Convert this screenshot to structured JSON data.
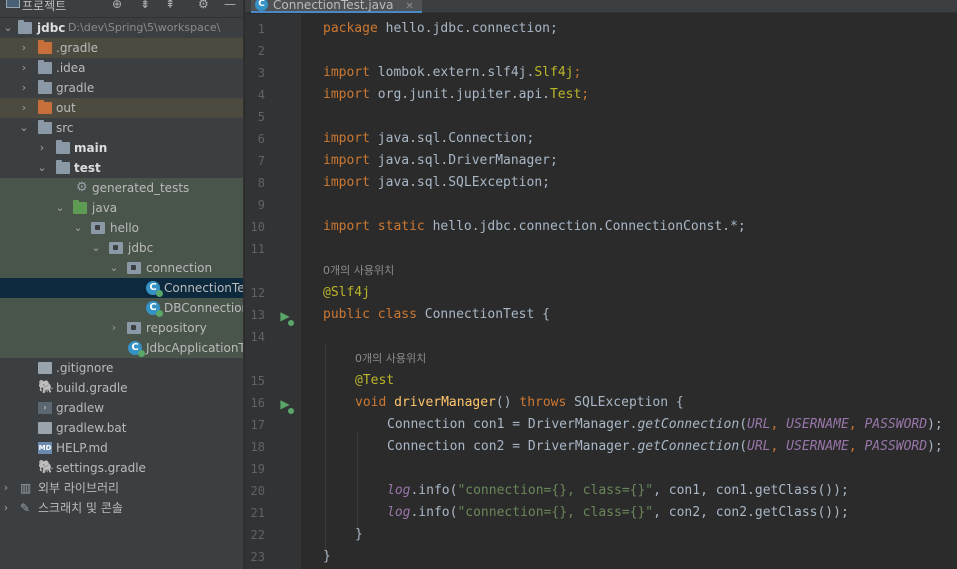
{
  "panel": {
    "title": "프로젝트",
    "toolbar_icons": [
      "locate-icon",
      "expand-icon",
      "collapse-icon",
      "gear-icon",
      "minimize-icon"
    ]
  },
  "tree": {
    "root": {
      "name": "jdbc",
      "path": "D:\\dev\\Spring\\5\\workspace\\"
    },
    "gradle_dir": ".gradle",
    "idea": ".idea",
    "gradle": "gradle",
    "out": "out",
    "src": "src",
    "main": "main",
    "test": "test",
    "generated_tests": "generated_tests",
    "java": "java",
    "hello": "hello",
    "jdbc_pkg": "jdbc",
    "connection_pkg": "connection",
    "connection_test": "ConnectionTes",
    "db_connection": "DBConnection",
    "repository": "repository",
    "jdbc_app_test": "JdbcApplicationTe",
    "gitignore": ".gitignore",
    "build_gradle": "build.gradle",
    "gradlew": "gradlew",
    "gradlew_bat": "gradlew.bat",
    "help_md": "HELP.md",
    "settings_gradle": "settings.gradle",
    "external_libs": "외부 라이브러리",
    "scratches": "스크래치 및 콘솔"
  },
  "editor": {
    "tab_label": "ConnectionTest.java",
    "usage_hint": "0개의 사용위치",
    "line_numbers": [
      "1",
      "2",
      "3",
      "4",
      "5",
      "6",
      "7",
      "8",
      "9",
      "10",
      "11",
      "12",
      "13",
      "14",
      "15",
      "16",
      "17",
      "18",
      "19",
      "20",
      "21",
      "22",
      "23"
    ],
    "code": {
      "l1_kw": "package",
      "l1_rest": " hello.jdbc.connection;",
      "import_kw": "import",
      "l3_pkg": " lombok.extern.slf4j.",
      "l3_cls": "Slf4j",
      "l3_end": ";",
      "l4_pkg": " org.junit.jupiter.api.",
      "l4_cls": "Test",
      "l4_end": ";",
      "l6_rest": " java.sql.Connection;",
      "l7_rest": " java.sql.DriverManager;",
      "l8_rest": " java.sql.SQLException;",
      "l10_static": " static",
      "l10_rest": " hello.jdbc.connection.ConnectionConst.*;",
      "l12_ann": "@Slf4j",
      "l13_public": "public",
      "l13_class": " class",
      "l13_name": " ConnectionTest {",
      "l15_ann": "@Test",
      "l16_void": "void",
      "l16_fn": " driverManager",
      "l16_mid": "()",
      "l16_throws": " throws",
      "l16_rest": " SQLException {",
      "l17_pre": "Connection con1 = DriverManager.",
      "l17_fn": "getConnection",
      "l18_pre": "Connection con2 = DriverManager.",
      "l18_fn": "getConnection",
      "args_open": "(",
      "arg_url": "URL",
      "arg_comma": ", ",
      "arg_user": "USERNAME",
      "arg_pass": "PASSWORD",
      "args_close": ");",
      "log": "log",
      "info": ".info(",
      "log_str": "\"connection={}, class={}\"",
      "l20_rest": ", con1, con1.getClass());",
      "l21_rest": ", con2, con2.getClass());",
      "close_brace": "}"
    }
  },
  "colors": {
    "keyword": "#cc7832",
    "annotation": "#bbb529",
    "function": "#ffc66d",
    "constant": "#9876aa",
    "string": "#6a8759",
    "text": "#a9b7c6"
  }
}
